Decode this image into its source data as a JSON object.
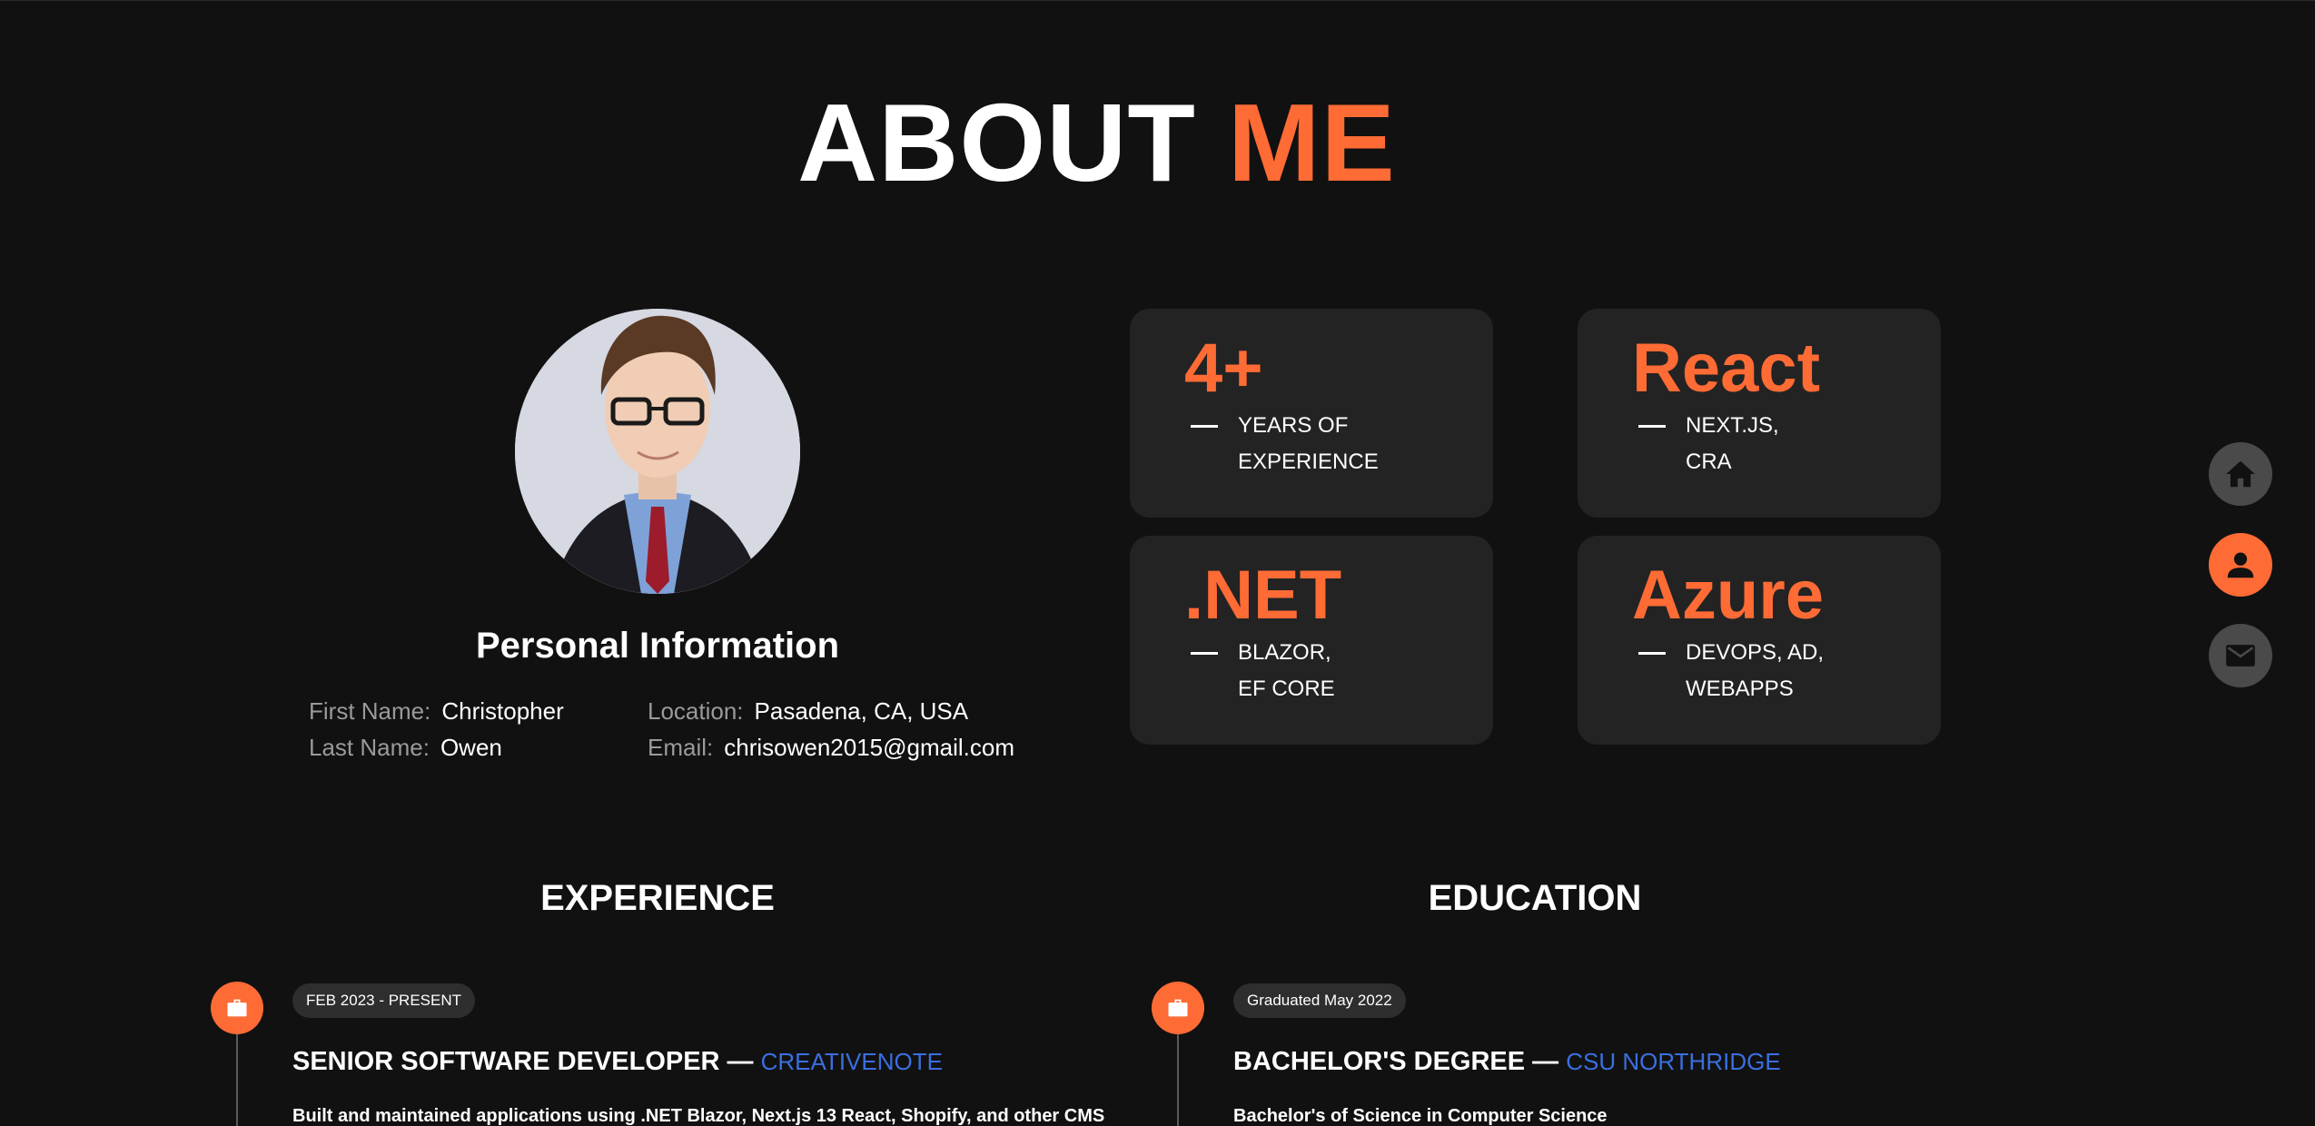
{
  "header": {
    "title_part1": "ABOUT",
    "title_part2": "ME"
  },
  "personal": {
    "heading": "Personal Information",
    "first_name_label": "First Name:",
    "first_name": "Christopher",
    "last_name_label": "Last Name:",
    "last_name": "Owen",
    "location_label": "Location:",
    "location": "Pasadena, CA, USA",
    "email_label": "Email:",
    "email": "chrisowen2015@gmail.com"
  },
  "stats": [
    {
      "big": "4+",
      "line1": "YEARS OF",
      "line2": "EXPERIENCE"
    },
    {
      "big": "React",
      "line1": "NEXT.JS,",
      "line2": "CRA"
    },
    {
      "big": ".NET",
      "line1": "BLAZOR,",
      "line2": "EF CORE"
    },
    {
      "big": "Azure",
      "line1": "DEVOPS, AD,",
      "line2": "WEBAPPS"
    }
  ],
  "nav": {
    "items": [
      "home-icon",
      "person-icon",
      "mail-icon"
    ],
    "active": "person-icon"
  },
  "experience": {
    "heading": "EXPERIENCE",
    "items": [
      {
        "date": "FEB 2023 - PRESENT",
        "title": "SENIOR SOFTWARE DEVELOPER",
        "separator": " — ",
        "org": "CREATIVENOTE",
        "desc": "Built and maintained applications using .NET Blazor, Next.js 13 React, Shopify, and other CMS"
      }
    ]
  },
  "education": {
    "heading": "EDUCATION",
    "items": [
      {
        "date": "Graduated May 2022",
        "title": "BACHELOR'S DEGREE",
        "separator": " — ",
        "org": "CSU NORTHRIDGE",
        "desc": "Bachelor's of Science in Computer Science"
      }
    ]
  },
  "colors": {
    "accent": "#ff6b35",
    "background": "#111111",
    "card": "#232323",
    "link": "#3a6fe0"
  }
}
